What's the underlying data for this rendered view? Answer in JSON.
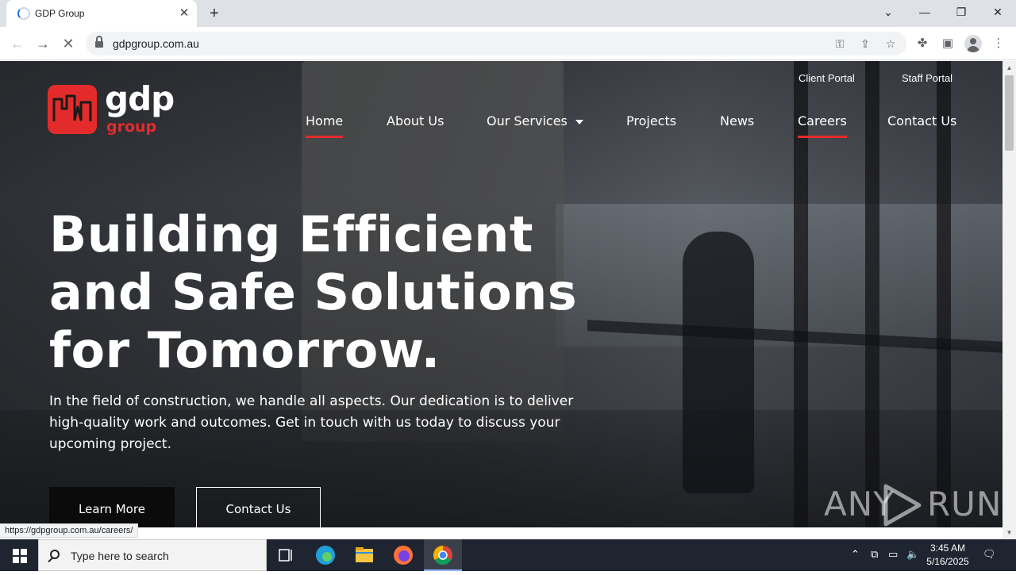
{
  "browser": {
    "tab_title": "GDP Group",
    "url": "gdpgroup.com.au",
    "status_url": "https://gdpgroup.com.au/careers/"
  },
  "site": {
    "logo_main": "gdp",
    "logo_sub": "group",
    "utility_links": [
      "Client Portal",
      "Staff Portal"
    ],
    "nav": {
      "home": "Home",
      "about": "About Us",
      "services": "Our Services",
      "projects": "Projects",
      "news": "News",
      "careers": "Careers",
      "contact": "Contact Us"
    },
    "hero_title_lines": [
      "Building Efficient",
      "and Safe Solutions",
      "for Tomorrow."
    ],
    "hero_copy_lines": [
      "In the field of construction, we handle all aspects. Our dedication is to deliver",
      "high-quality work and outcomes. Get in touch with us today to discuss your",
      "upcoming project."
    ],
    "cta_primary": "Learn More",
    "cta_secondary": "Contact Us",
    "accent_color": "#e32b2b"
  },
  "watermark": {
    "left": "ANY",
    "right": "RUN"
  },
  "taskbar": {
    "search_placeholder": "Type here to search",
    "time": "3:45 AM",
    "date": "5/16/2025"
  }
}
